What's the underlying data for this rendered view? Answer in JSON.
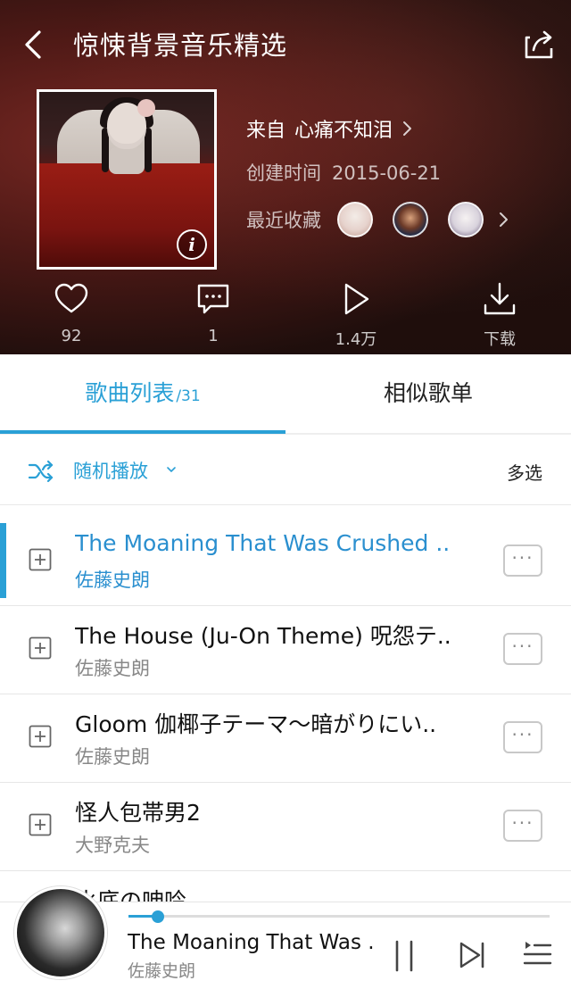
{
  "header": {
    "title": "惊悚背景音乐精选",
    "from_label": "来自",
    "from_user": "心痛不知泪",
    "created_label": "创建时间",
    "created_date": "2015-06-21",
    "recent_fav_label": "最近收藏"
  },
  "stats": {
    "likes": "92",
    "comments": "1",
    "plays": "1.4万",
    "download_label": "下载"
  },
  "tabs": {
    "songs_label": "歌曲列表",
    "songs_count": "/31",
    "similar_label": "相似歌单"
  },
  "toolbar": {
    "shuffle_label": "随机播放",
    "multi_select_label": "多选"
  },
  "songs": [
    {
      "title": "The Moaning That Was Crushed ..",
      "artist": "佐藤史朗"
    },
    {
      "title": "The House (Ju-On Theme) 呪怨テ..",
      "artist": "佐藤史朗"
    },
    {
      "title": "Gloom 伽椰子テーマ〜暗がりにい..",
      "artist": "佐藤史朗"
    },
    {
      "title": "怪人包帯男2",
      "artist": "大野克夫"
    },
    {
      "title": "水底の呻吟",
      "artist": ""
    }
  ],
  "player": {
    "title": "The Moaning That Was ..",
    "artist": "佐藤史朗",
    "progress": 0.07
  },
  "colors": {
    "accent": "#2aa0d6"
  }
}
